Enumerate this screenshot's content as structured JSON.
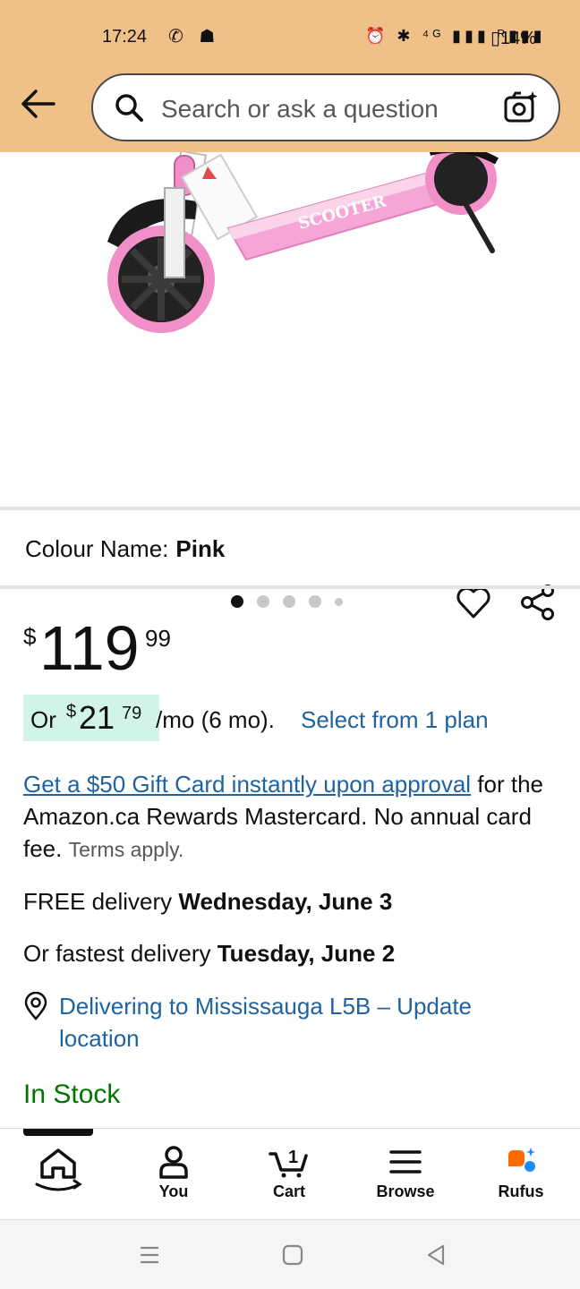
{
  "status_bar": {
    "time": "17:24",
    "app_icons": "✆ ☗",
    "system_icons": "⏰ ✱ ⁴ᴳ ▮▮▮ ᴿ▮▮▮",
    "battery": "14%"
  },
  "search": {
    "placeholder": "Search or ask a question"
  },
  "product": {
    "image_text": "SCOOTER",
    "carousel_total": 5,
    "carousel_active": 1,
    "colour_label": "Colour Name:",
    "colour_value": "Pink"
  },
  "price": {
    "currency": "$",
    "whole": "119",
    "fraction": "99"
  },
  "monthly": {
    "or": "Or",
    "currency": "$",
    "whole": "21",
    "fraction": "79",
    "term": "/mo (6 mo).",
    "plan_link": "Select from 1 plan"
  },
  "gift_card": {
    "link": "Get a $50 Gift Card instantly upon approval",
    "text": " for the Amazon.ca Rewards Mastercard. No annual card fee. ",
    "terms": "Terms apply."
  },
  "delivery": {
    "free_prefix": "FREE delivery ",
    "free_date": "Wednesday, June 3",
    "fast_prefix": "Or fastest delivery ",
    "fast_date": "Tuesday, June 2",
    "location": "Delivering to Mississauga L5B – Update location"
  },
  "stock": "In Stock",
  "nav": {
    "items": [
      {
        "label": ""
      },
      {
        "label": "You"
      },
      {
        "label": "Cart"
      },
      {
        "label": "Browse"
      },
      {
        "label": "Rufus"
      }
    ],
    "cart_count": "1"
  },
  "colors": {
    "header": "#f0c089",
    "link": "#2162a1",
    "in_stock": "#007600",
    "pill": "#d2f4e6",
    "scooter_pink": "#f08fc8"
  }
}
